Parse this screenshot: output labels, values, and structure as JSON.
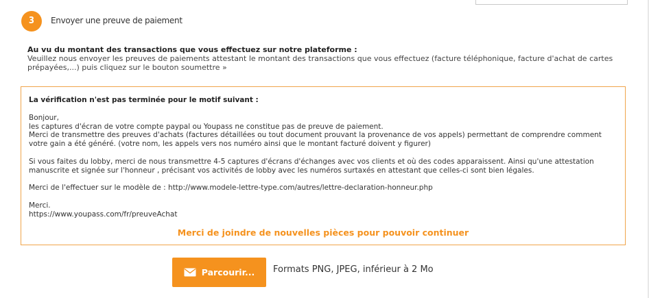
{
  "step": {
    "number": "3",
    "title": "Envoyer une preuve de paiement"
  },
  "intro": {
    "heading": "Au vu du montant des transactions que vous effectuez sur notre plateforme :",
    "text": "Veuillez nous envoyer les preuves de paiements attestant le montant des transactions que vous effectuez (facture téléphonique, facture d'achat de cartes prépayées,...) puis cliquez sur le bouton soumettre »"
  },
  "verification": {
    "heading": "La vérification n'est pas terminée pour le motif suivant :",
    "message": "Bonjour,\nles captures d'écran de votre  compte paypal ou Youpass ne constitue pas de preuve de paiement.\nMerci de transmettre des preuves d'achats (factures détaillées ou tout document prouvant la provenance de vos appels) permettant de comprendre comment\nvotre gain a été généré. (votre nom, les appels vers nos numéro ainsi que le montant facturé doivent y figurer)\n\nSi vous faites du lobby, merci de nous transmettre 4-5 captures d'écrans d'échanges avec vos clients et où des codes apparaissent. Ainsi qu'une attestation\nmanuscrite et signée sur l'honneur , précisant vos activités de lobby avec les numéros surtaxés en attestant que celles-ci sont bien légales.\n\nMerci de l'effectuer sur le modèle de : http://www.modele-lettre-type.com/autres/lettre-declaration-honneur.php\n\nMerci.\nhttps://www.youpass.com/fr/preuveAchat",
    "continue_message": "Merci de joindre de nouvelles pièces pour pouvoir continuer"
  },
  "upload": {
    "browse_label": "Parcourir...",
    "icon": "envelope-icon",
    "formats_text": "Formats PNG, JPEG, inférieur à 2 Mo"
  },
  "colors": {
    "accent": "#f5921e",
    "border": "#f0a44a"
  }
}
